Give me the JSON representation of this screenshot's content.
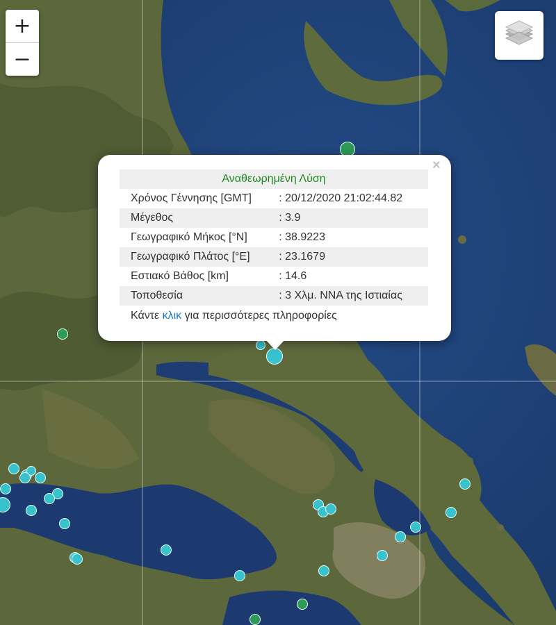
{
  "map": {
    "zoom_in_label": "+",
    "zoom_out_label": "−",
    "layers_icon": "layers-stack-icon",
    "colors": {
      "sea": "#1d3f78",
      "land": "#5f6a3c",
      "marker_revised": "#37c2cc",
      "marker_auto": "#2e9a55"
    },
    "markers": [
      {
        "kind": "auto"
      },
      {
        "kind": "auto"
      },
      {
        "kind": "revised-selected"
      },
      {
        "kind": "revised"
      },
      {
        "kind": "revised"
      },
      {
        "kind": "revised"
      },
      {
        "kind": "revised"
      },
      {
        "kind": "revised"
      },
      {
        "kind": "revised"
      },
      {
        "kind": "revised"
      },
      {
        "kind": "revised"
      },
      {
        "kind": "revised"
      },
      {
        "kind": "revised"
      },
      {
        "kind": "revised"
      },
      {
        "kind": "revised"
      },
      {
        "kind": "revised"
      },
      {
        "kind": "revised"
      },
      {
        "kind": "revised"
      },
      {
        "kind": "revised"
      },
      {
        "kind": "revised"
      },
      {
        "kind": "revised"
      },
      {
        "kind": "revised"
      },
      {
        "kind": "revised"
      },
      {
        "kind": "revised"
      },
      {
        "kind": "revised"
      },
      {
        "kind": "revised"
      },
      {
        "kind": "revised"
      },
      {
        "kind": "auto"
      },
      {
        "kind": "auto"
      },
      {
        "kind": "revised"
      }
    ]
  },
  "popup": {
    "title": "Αναθεωρημένη Λύση",
    "close_label": "×",
    "rows": [
      {
        "key": "Χρόνος Γέννησης [GMT]",
        "value": ": 20/12/2020 21:02:44.82"
      },
      {
        "key": "Μέγεθος",
        "value": ": 3.9"
      },
      {
        "key": "Γεωγραφικό Μήκος [°N]",
        "value": ": 38.9223"
      },
      {
        "key": "Γεωγραφικό Πλάτος [°E]",
        "value": ": 23.1679"
      },
      {
        "key": "Εστιακό Βάθος [km]",
        "value": ": 14.6"
      },
      {
        "key": "Τοποθεσία",
        "value": ": 3 Χλμ. ΝΝΑ της Ιστιαίας"
      }
    ],
    "footer_prefix": "Κάντε ",
    "footer_link": "κλικ",
    "footer_suffix": " για περισσότερες πληροφορίες"
  }
}
